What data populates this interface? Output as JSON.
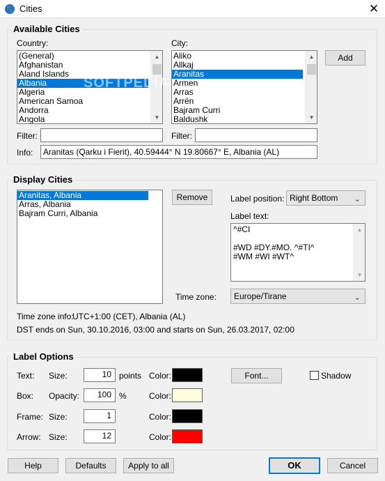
{
  "window": {
    "title": "Cities",
    "close_glyph": "✕"
  },
  "available": {
    "title": "Available Cities",
    "country_label": "Country:",
    "countries": [
      "(General)",
      "Afghanistan",
      "Aland Islands",
      "Albania",
      "Algeria",
      "American Samoa",
      "Andorra",
      "Angola"
    ],
    "country_selected_index": 3,
    "city_label": "City:",
    "cities": [
      "Aliko",
      "Allkaj",
      "Aranitas",
      "Armen",
      "Arras",
      "Arrën",
      "Bajram Curri",
      "Baldushk"
    ],
    "city_selected_index": 2,
    "add_label": "Add",
    "filter_label": "Filter:",
    "filter_country_value": "",
    "filter_city_label": "Filter:",
    "filter_city_value": "",
    "info_label": "Info:",
    "info_value": "Aranitas (Qarku i Fierit), 40.59444° N  19.80667° E, Albania (AL)"
  },
  "display": {
    "title": "Display Cities",
    "list": [
      "Aranitas, Albania",
      "Arras, Albania",
      "Bajram Curri, Albania"
    ],
    "list_selected_index": 0,
    "remove_label": "Remove",
    "label_position_label": "Label position:",
    "label_position_value": "Right Bottom",
    "label_text_label": "Label text:",
    "label_text_lines": [
      "^#CI",
      "",
      "#WD #DY.#MO. ^#TI^",
      "#WM #WI #WT^"
    ],
    "timezone_label": "Time zone:",
    "timezone_value": "Europe/Tirane",
    "tz_info_label": "Time zone info:",
    "tz_info_value": "UTC+1:00 (CET), Albania (AL)",
    "dst_text": "DST ends on Sun, 30.10.2016, 03:00 and starts on Sun, 26.03.2017, 02:00"
  },
  "label_options": {
    "title": "Label Options",
    "rows": [
      {
        "name": "Text:",
        "param": "Size:",
        "value": "10",
        "unit": "points",
        "color_label": "Color:",
        "color": "#000000"
      },
      {
        "name": "Box:",
        "param": "Opacity:",
        "value": "100",
        "unit": "%",
        "color_label": "Color:",
        "color": "#ffffe0"
      },
      {
        "name": "Frame:",
        "param": "Size:",
        "value": "1",
        "unit": "",
        "color_label": "Color:",
        "color": "#000000"
      },
      {
        "name": "Arrow:",
        "param": "Size:",
        "value": "12",
        "unit": "",
        "color_label": "Color:",
        "color": "#ff0000"
      }
    ],
    "font_label": "Font...",
    "shadow_label": "Shadow",
    "shadow_checked": false
  },
  "footer": {
    "help_label": "Help",
    "defaults_label": "Defaults",
    "apply_label": "Apply to all",
    "ok_label": "OK",
    "cancel_label": "Cancel"
  },
  "watermark": "SOFTPEDIA",
  "colors": {
    "accent": "#0078d7",
    "selection_text": "#ffffff"
  }
}
